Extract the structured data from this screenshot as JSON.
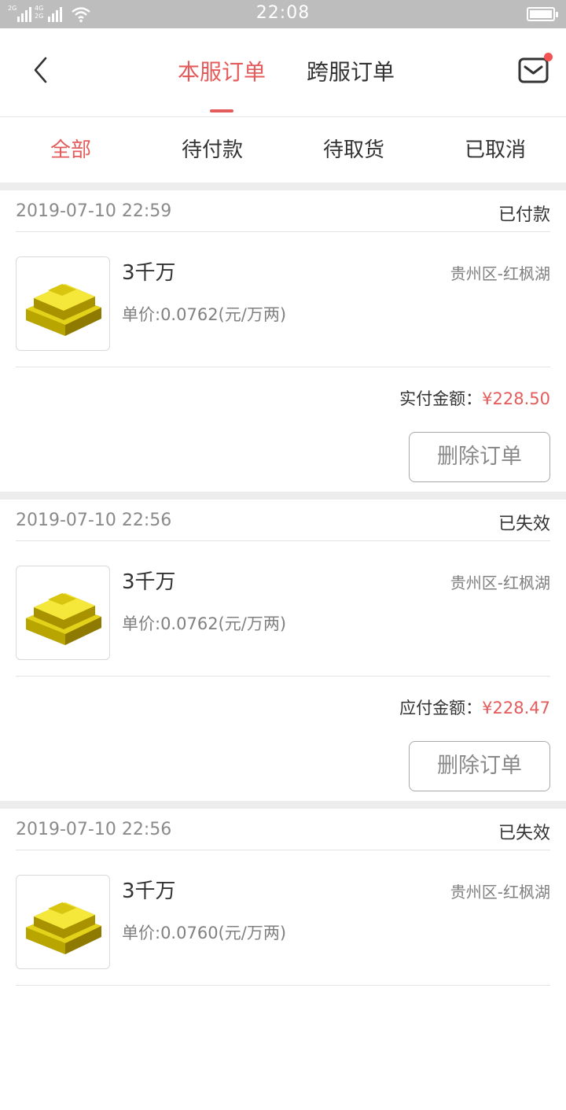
{
  "status_bar": {
    "time": "22:08",
    "sim1_label": "2G",
    "sim2_label_top": "4G",
    "sim2_label_bottom": "2G"
  },
  "header": {
    "tabs": [
      {
        "label": "本服订单",
        "active": true
      },
      {
        "label": "跨服订单",
        "active": false
      }
    ],
    "accent_color": "#e45b5b"
  },
  "filters": [
    {
      "label": "全部",
      "active": true
    },
    {
      "label": "待付款",
      "active": false
    },
    {
      "label": "待取货",
      "active": false
    },
    {
      "label": "已取消",
      "active": false
    }
  ],
  "orders": [
    {
      "time": "2019-07-10 22:59",
      "status": "已付款",
      "product_name": "3千万",
      "unit_price": "单价:0.0762(元/万两)",
      "server": "贵州区-红枫湖",
      "amount_label": "实付金额：",
      "amount": "¥228.50",
      "delete_label": "删除订单"
    },
    {
      "time": "2019-07-10 22:56",
      "status": "已失效",
      "product_name": "3千万",
      "unit_price": "单价:0.0762(元/万两)",
      "server": "贵州区-红枫湖",
      "amount_label": "应付金额：",
      "amount": "¥228.47",
      "delete_label": "删除订单"
    },
    {
      "time": "2019-07-10 22:56",
      "status": "已失效",
      "product_name": "3千万",
      "unit_price": "单价:0.0760(元/万两)",
      "server": "贵州区-红枫湖",
      "amount_label": "",
      "amount": "",
      "delete_label": ""
    }
  ],
  "icons": {
    "back": "chevron-left-icon",
    "mail": "mail-icon",
    "product": "gold-bars-icon"
  }
}
